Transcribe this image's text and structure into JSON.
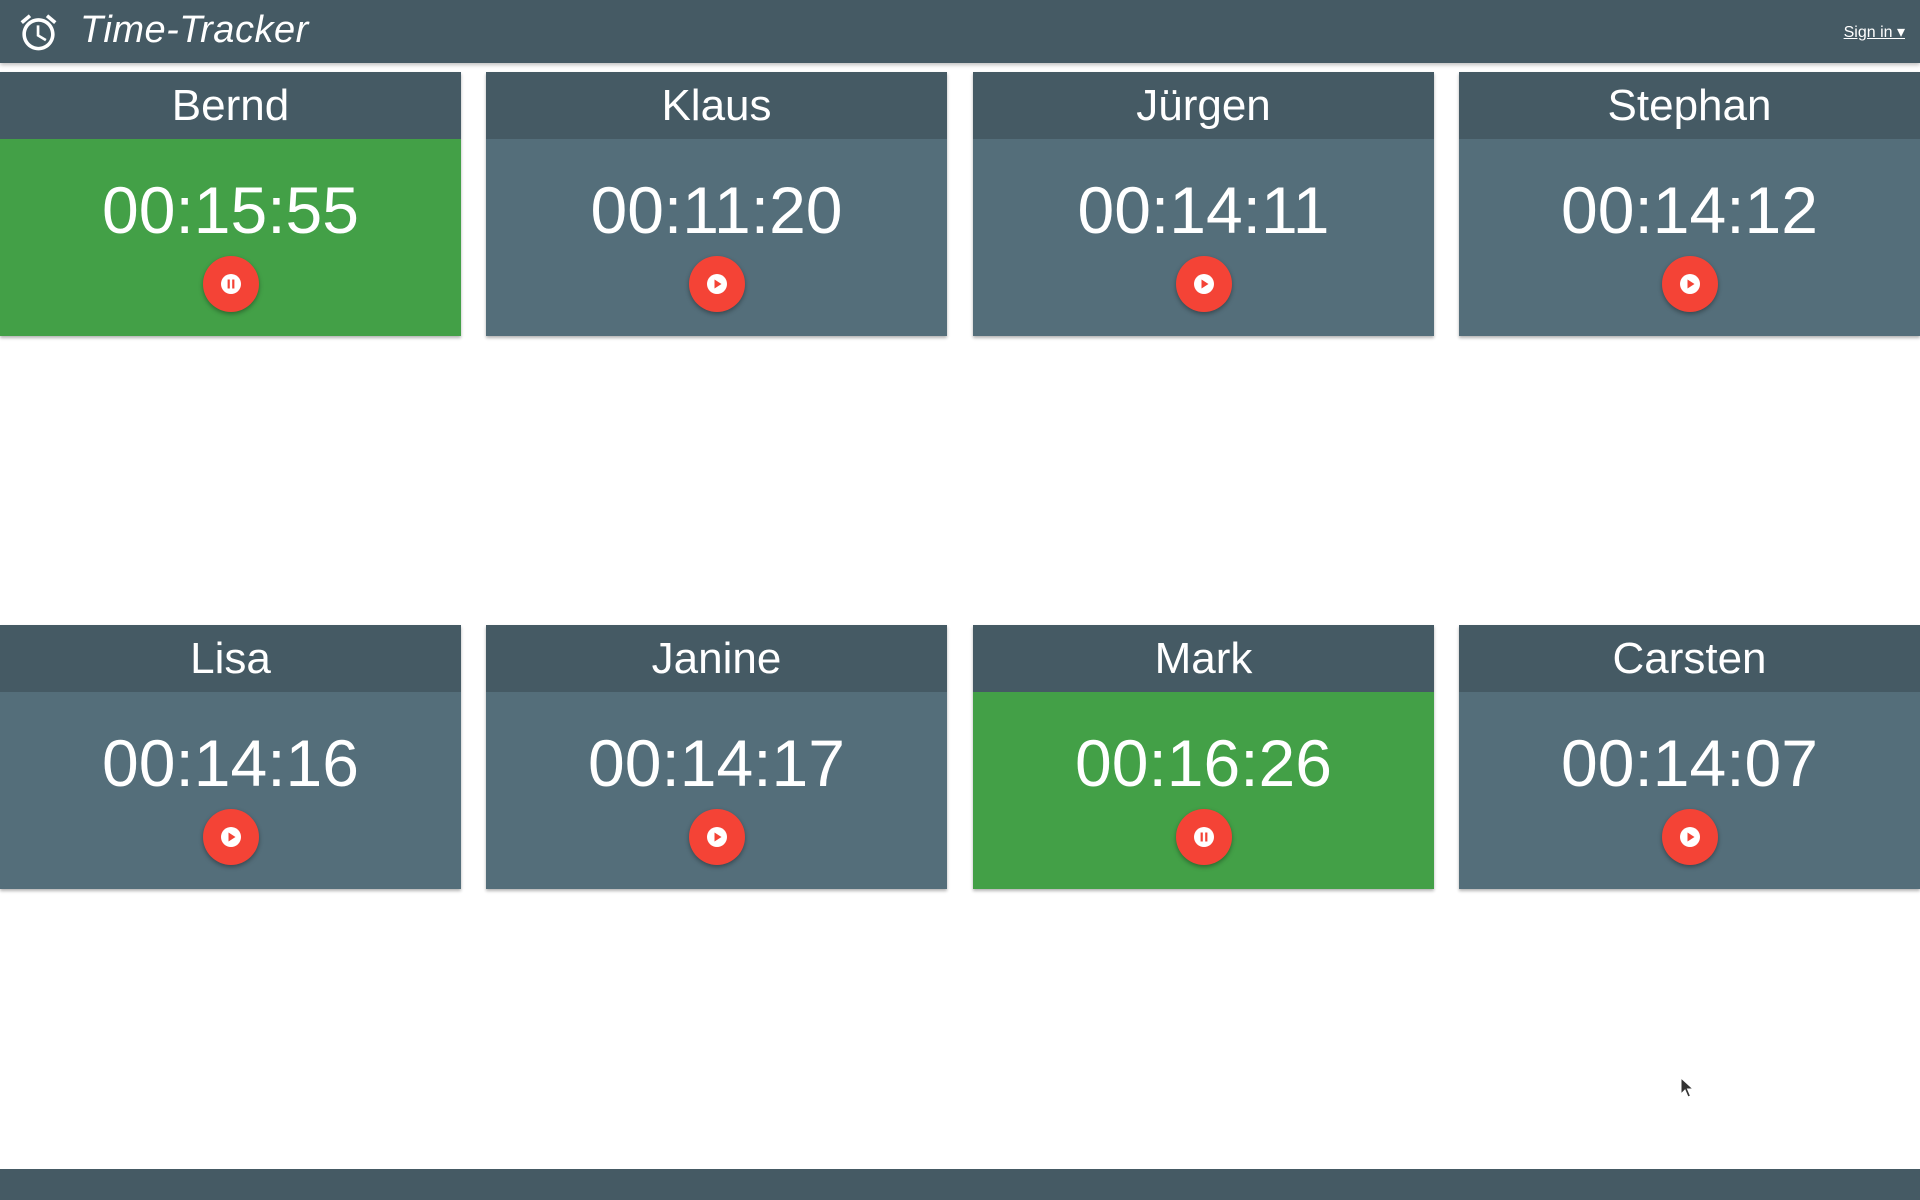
{
  "app": {
    "title": "Time-Tracker",
    "icon": "alarm-clock-icon",
    "signin_label": "Sign in ▾"
  },
  "colors": {
    "header": "#455a64",
    "card_idle": "#546e7a",
    "card_running": "#43a047",
    "fab": "#f44336"
  },
  "timers": [
    {
      "name": "Bernd",
      "time": "00:15:55",
      "state": "running",
      "button_icon": "pause-icon"
    },
    {
      "name": "Klaus",
      "time": "00:11:20",
      "state": "stopped",
      "button_icon": "play-icon"
    },
    {
      "name": "Jürgen",
      "time": "00:14:11",
      "state": "stopped",
      "button_icon": "play-icon"
    },
    {
      "name": "Stephan",
      "time": "00:14:12",
      "state": "stopped",
      "button_icon": "play-icon"
    },
    {
      "name": "Lisa",
      "time": "00:14:16",
      "state": "stopped",
      "button_icon": "play-icon"
    },
    {
      "name": "Janine",
      "time": "00:14:17",
      "state": "stopped",
      "button_icon": "play-icon"
    },
    {
      "name": "Mark",
      "time": "00:16:26",
      "state": "running",
      "button_icon": "pause-icon"
    },
    {
      "name": "Carsten",
      "time": "00:14:07",
      "state": "stopped",
      "button_icon": "play-icon"
    }
  ]
}
